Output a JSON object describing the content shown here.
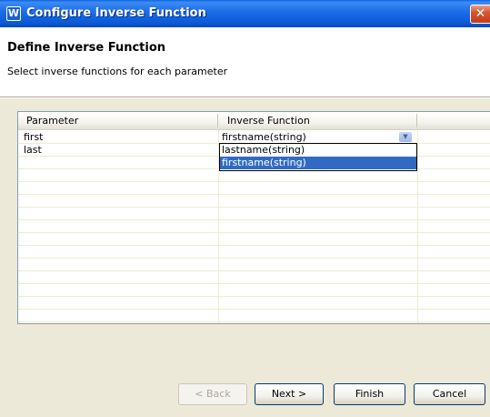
{
  "window": {
    "title": "Configure Inverse Function",
    "icon": "app-logo-icon"
  },
  "header": {
    "title": "Define Inverse Function",
    "description": "Select inverse functions for each parameter"
  },
  "table": {
    "columns": [
      "Parameter",
      "Inverse Function"
    ],
    "rows": [
      {
        "parameter": "first",
        "inverse_function": "firstname(string)"
      },
      {
        "parameter": "last",
        "inverse_function": ""
      }
    ]
  },
  "combo": {
    "selected": "firstname(string)",
    "options": [
      "lastname(string)",
      "firstname(string)"
    ],
    "highlighted_option": "firstname(string)"
  },
  "buttons": {
    "back": "< Back",
    "next": "Next >",
    "finish": "Finish",
    "cancel": "Cancel"
  },
  "colors": {
    "titlebar": "#0a5ad6",
    "selection": "#316ac5",
    "dialog_bg": "#ece9d8"
  }
}
